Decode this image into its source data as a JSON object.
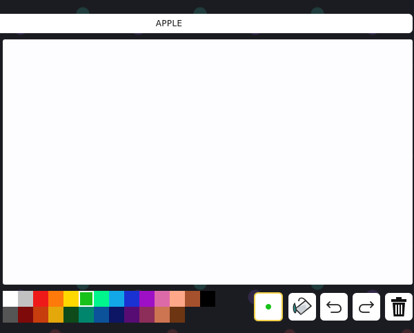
{
  "header": {
    "title": "APPLE"
  },
  "palette": {
    "top_row": [
      "#ffffff",
      "#c2c2c2",
      "#ee1a1a",
      "#ff7a0a",
      "#ffd800",
      "#18c21a",
      "#00f58c",
      "#12a8e8",
      "#1a32d2",
      "#9e10c6",
      "#dd6aa8",
      "#ffa889",
      "#a5512d"
    ],
    "bottom_row": [
      "#000000",
      "#555555",
      "#7e0a0a",
      "#c73d0e",
      "#e4a80a",
      "#0f4a1a",
      "#00866d",
      "#0c529a",
      "#0c1665",
      "#570c73",
      "#8d2d5a",
      "#cd7451",
      "#6d3511"
    ],
    "selected_color": "#18c21a"
  },
  "tools": {
    "brush": {
      "icon": "brush-dot-icon",
      "color": "#18c21a",
      "border_color": "#f1cf45"
    },
    "fill": {
      "icon": "paint-bucket-icon"
    },
    "undo": {
      "icon": "undo-arrow-icon"
    },
    "redo": {
      "icon": "redo-arrow-icon"
    },
    "clear": {
      "icon": "trash-can-icon"
    }
  }
}
